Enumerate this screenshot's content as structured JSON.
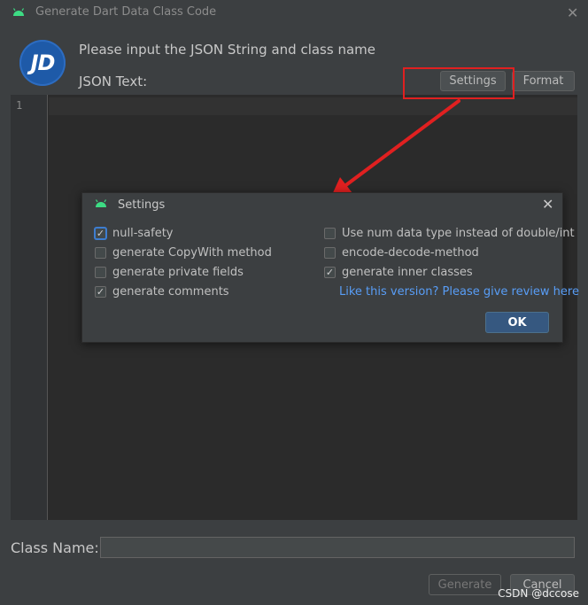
{
  "window": {
    "title": "Generate Dart Data Class Code",
    "close_glyph": "✕",
    "logo_text": "JD"
  },
  "main": {
    "prompt": "Please input the JSON String and class name",
    "json_label": "JSON Text:",
    "settings_label": "Settings",
    "format_label": "Format",
    "line_number": "1"
  },
  "settings_dialog": {
    "title": "Settings",
    "close_glyph": "✕",
    "left_options": [
      {
        "label": "null-safety",
        "checked": true,
        "mark": "✓"
      },
      {
        "label": "generate CopyWith method",
        "checked": false,
        "mark": ""
      },
      {
        "label": "generate private fields",
        "checked": false,
        "mark": ""
      },
      {
        "label": "generate comments",
        "checked": true,
        "mark": "✓"
      }
    ],
    "right_options": [
      {
        "label": "Use num data type instead of double/int",
        "checked": false,
        "mark": ""
      },
      {
        "label": "encode-decode-method",
        "checked": false,
        "mark": ""
      },
      {
        "label": "generate inner classes",
        "checked": true,
        "mark": "✓"
      }
    ],
    "review_link": "Like this version? Please give review here",
    "ok_label": "OK"
  },
  "footer": {
    "class_name_label": "Class Name:",
    "class_name_value": "",
    "generate_label": "Generate",
    "cancel_label": "Cancel"
  },
  "watermark": "CSDN @dccose",
  "colors": {
    "background": "#3c3f41",
    "editor": "#2b2b2b",
    "annotation_red": "#e02020",
    "link": "#589df6",
    "ok_button": "#365880",
    "android_green": "#3ddc84"
  },
  "icons": {
    "title_icon": "android-icon",
    "dialog_icon": "android-icon"
  }
}
